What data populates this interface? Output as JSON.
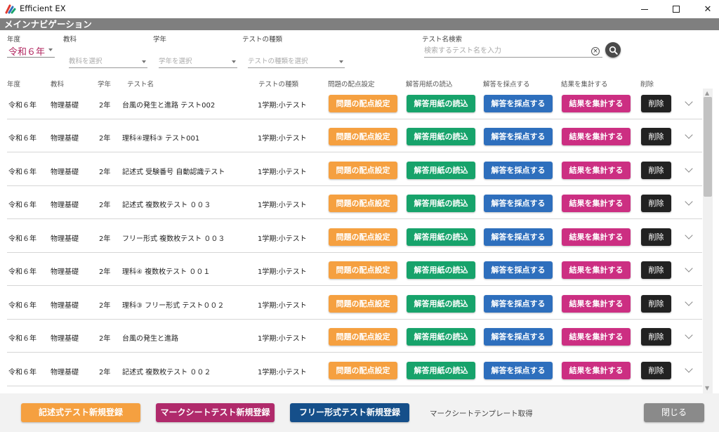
{
  "window": {
    "title": "Efficient EX"
  },
  "header": {
    "title": "メインナビゲーション"
  },
  "filters": {
    "year_label": "年度",
    "year_value": "令和６年",
    "subject_label": "教科",
    "subject_placeholder": "教科を選択",
    "grade_label": "学年",
    "grade_placeholder": "学年を選択",
    "type_label": "テストの種類",
    "type_placeholder": "テストの種類を選択",
    "search_label": "テスト名検索",
    "search_placeholder": "検索するテスト名を入力"
  },
  "columns": [
    "年度",
    "教科",
    "学年",
    "テスト名",
    "テストの種類",
    "問題の配点設定",
    "解答用紙の読込",
    "解答を採点する",
    "結果を集計する",
    "削除"
  ],
  "buttons": {
    "score_setting": "問題の配点設定",
    "read_sheets": "解答用紙の読込",
    "grade_answers": "解答を採点する",
    "aggregate": "結果を集計する",
    "delete": "削除"
  },
  "rows": [
    {
      "year": "令和６年",
      "subject": "物理基礎",
      "grade": "2年",
      "name": "台風の発生と進路 テスト002",
      "type": "1学期:小テスト"
    },
    {
      "year": "令和６年",
      "subject": "物理基礎",
      "grade": "2年",
      "name": "理科④理科③ テスト001",
      "type": "1学期:小テスト"
    },
    {
      "year": "令和６年",
      "subject": "物理基礎",
      "grade": "2年",
      "name": "記述式 受験番号 自動認識テスト",
      "type": "1学期:小テスト"
    },
    {
      "year": "令和６年",
      "subject": "物理基礎",
      "grade": "2年",
      "name": "記述式 複数枚テスト ００３",
      "type": "1学期:小テスト"
    },
    {
      "year": "令和６年",
      "subject": "物理基礎",
      "grade": "2年",
      "name": "フリー形式 複数枚テスト ００３",
      "type": "1学期:小テスト"
    },
    {
      "year": "令和６年",
      "subject": "物理基礎",
      "grade": "2年",
      "name": "理科④ 複数枚テスト ００１",
      "type": "1学期:小テスト"
    },
    {
      "year": "令和６年",
      "subject": "物理基礎",
      "grade": "2年",
      "name": "理科③ フリー形式 テスト００２",
      "type": "1学期:小テスト"
    },
    {
      "year": "令和６年",
      "subject": "物理基礎",
      "grade": "2年",
      "name": "台風の発生と進路",
      "type": "1学期:小テスト"
    },
    {
      "year": "令和６年",
      "subject": "物理基礎",
      "grade": "2年",
      "name": "記述式 複数枚テスト ００２",
      "type": "1学期:小テスト"
    }
  ],
  "footer": {
    "new_written": "記述式テスト新規登録",
    "new_marksheet": "マークシートテスト新規登録",
    "new_free": "フリー形式テスト新規登録",
    "template": "マークシートテンプレート取得",
    "close": "閉じる"
  },
  "colors": {
    "score": "#f5a040",
    "read": "#17a36b",
    "grade": "#2e6fbd",
    "aggregate": "#cc2f82",
    "delete": "#222222",
    "header_band": "#7f7f7f"
  },
  "icons": [
    "app-logo-icon",
    "minimize-icon",
    "maximize-icon",
    "close-icon",
    "clear-icon",
    "search-icon",
    "chevron-down-icon"
  ]
}
